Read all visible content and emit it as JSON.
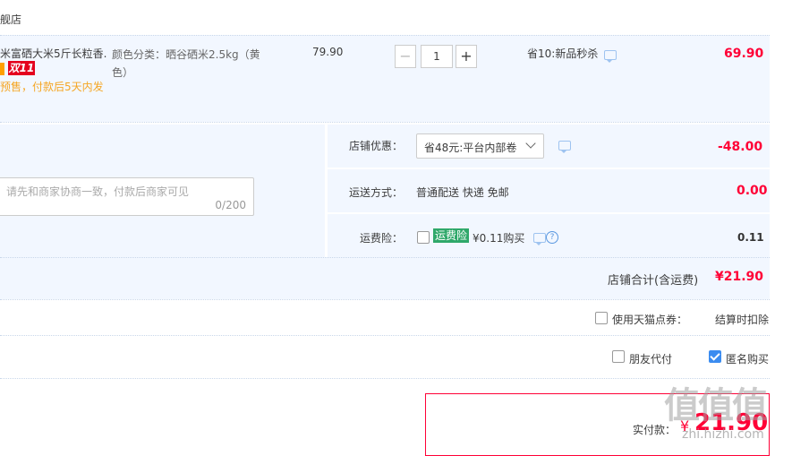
{
  "shop": {
    "name": "舰店"
  },
  "item": {
    "title": "米富硒大米5斤长粒香...",
    "badge": "双11",
    "presale": "预售，付款后5天内发",
    "sku": "颜色分类：晒谷硒米2.5kg（黄色）",
    "unit_price": "79.90",
    "quantity": "1",
    "minus": "−",
    "plus": "+",
    "promo": "省10:新品秒杀",
    "subtotal": "69.90"
  },
  "shop_discount": {
    "label": "店铺优惠：",
    "selected": "省48元:平台内部卷",
    "amount": "-48.00"
  },
  "message": {
    "placeholder": "请先和商家协商一致，付款后商家可见",
    "counter": "0/200"
  },
  "delivery": {
    "label": "运送方式：",
    "value": "普通配送 快递 免邮",
    "amount": "0.00"
  },
  "insurance": {
    "label": "运费险：",
    "tag": "运费险",
    "value": "¥0.11购买",
    "help": "?",
    "amount": "0.11"
  },
  "shop_total": {
    "label": "店铺合计(含运费)",
    "amount": "¥21.90"
  },
  "points": {
    "label": "使用天猫点券：",
    "note": "结算时扣除"
  },
  "options": {
    "friend_pay": "朋友代付",
    "anonymous": "匿名购买"
  },
  "payment": {
    "label": "实付款：",
    "currency": "¥",
    "amount": "21.90"
  },
  "watermark": {
    "text": "值值值",
    "site": "zhi.hizhi.com"
  }
}
